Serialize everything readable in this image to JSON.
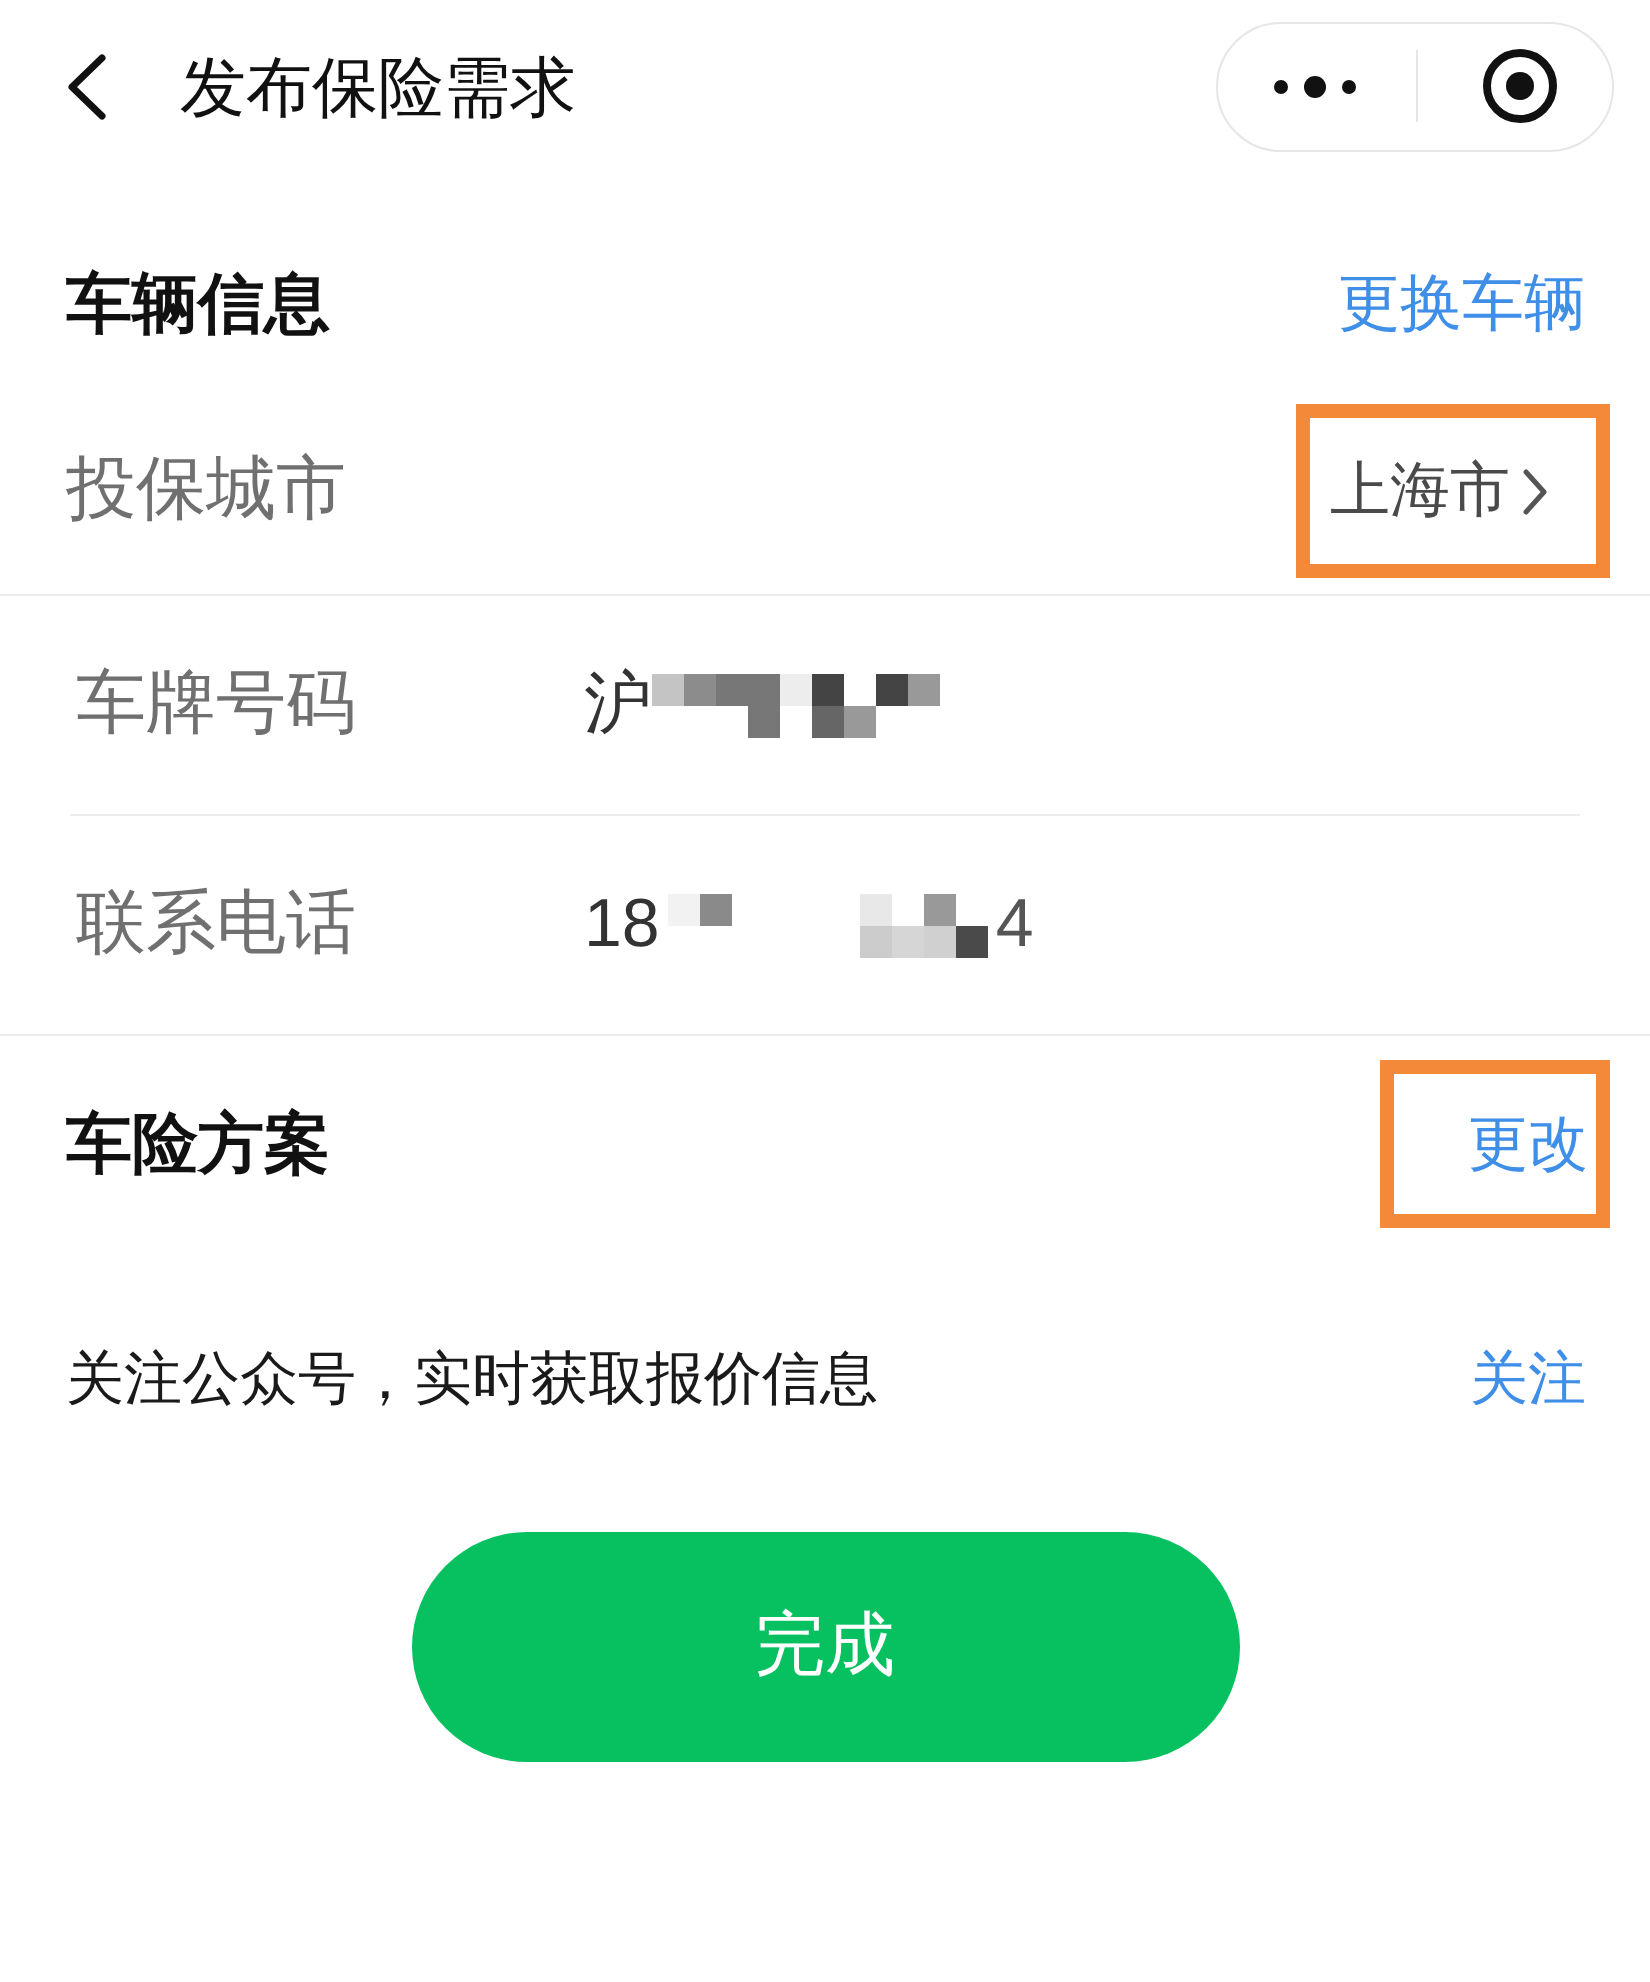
{
  "nav_bar": {
    "title": "发布保险需求"
  },
  "vehicle_section": {
    "title": "车辆信息",
    "action": "更换车辆",
    "city_row": {
      "label": "投保城市",
      "value": "上海市",
      "highlighted": true
    },
    "fields": [
      {
        "label": "车牌号码",
        "value_before": "沪",
        "redacted": true
      },
      {
        "label": "联系电话",
        "value_before": "18",
        "value_after": "4",
        "redacted": true
      }
    ]
  },
  "plan_section": {
    "title": "车险方案",
    "action": "更改",
    "highlighted": true
  },
  "follow_bar": {
    "text": "关注公众号，实时获取报价信息",
    "action": "关注"
  },
  "submit_button": {
    "label": "完成"
  }
}
